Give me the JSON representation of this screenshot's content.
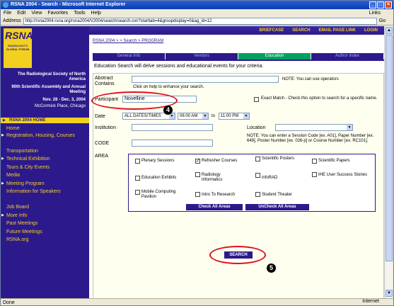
{
  "window": {
    "title": "RSNA 2004 - Search - Microsoft Internet Explorer",
    "controls": [
      "_",
      "□",
      "×"
    ]
  },
  "menu": [
    "File",
    "Edit",
    "View",
    "Favorites",
    "Tools",
    "Help"
  ],
  "links_label": "Links",
  "address": {
    "label": "Address",
    "url": "http://rsna2004.rsna.org/rsna2004/V2004/search/search.cvn?starttab=4&groupdisplay=0&ag_id=12",
    "go": "Go"
  },
  "sidebar": {
    "logo_big": "RSNA'04",
    "logo_sub": "RADIOLOGY'S GLOBAL FORUM",
    "society": "The Radiological Society of North America",
    "assembly": "90th Scientific Assembly and Annual Meeting",
    "dates": "Nov. 28 - Dec. 3, 2004",
    "place": "McCormick Place, Chicago",
    "nav_head": "RSNA 2004 HOME",
    "items": [
      {
        "label": "Home",
        "tri": false
      },
      {
        "label": "Registration, Housing, Courses",
        "tri": true
      },
      {
        "label": "Transportation",
        "tri": false
      },
      {
        "label": "Technical Exhibition",
        "tri": true
      },
      {
        "label": "Tours & City Events",
        "tri": false
      },
      {
        "label": "Media",
        "tri": false
      },
      {
        "label": "Meeting Program",
        "tri": true
      },
      {
        "label": "Information for Speakers",
        "tri": false
      },
      {
        "label": "Job Board",
        "tri": false
      },
      {
        "label": "More Info",
        "tri": true
      },
      {
        "label": "Past Meetings",
        "tri": false
      },
      {
        "label": "Future Meetings",
        "tri": false
      },
      {
        "label": "RSNA.org",
        "tri": false
      }
    ]
  },
  "topbar": [
    "BRIEFCASE",
    "SEARCH",
    "EMAIL PAGE LINK",
    "LOGIN"
  ],
  "breadcrumb": "RSNA 2004 > > Search > PROGRAM",
  "tabs": [
    "General Info",
    "Vendors",
    "Education",
    "Author Index"
  ],
  "intro": "Education Search will delve sessions and educational events for your criteria.",
  "form": {
    "abstract_label": "Abstract Contains",
    "abstract_note": "NOTE: You can use operators",
    "hint": "Click on help to enhance your search.",
    "participant_label": "Participant",
    "participant_value": "Novelline",
    "exact_match": "Exact Match - Check this option to search for a specific name.",
    "date_label": "Date",
    "date_value": "ALL DATES/TIMES",
    "time_from": "06:00 AM",
    "to": "to",
    "time_to": "11:00 PM",
    "institution_label": "Institution",
    "location_label": "Location",
    "code_label": "CODE",
    "code_note": "NOTE: You can enter a Session Code [ex. A01], Paper Number [ex. 649], Poster Number [ex. 026-p] or Course Number [ex. RC101].",
    "area_label": "AREA",
    "areas": [
      {
        "label": "Plenary Sessions",
        "checked": false
      },
      {
        "label": "Refresher Courses",
        "checked": true
      },
      {
        "label": "Scientific Posters",
        "checked": false
      },
      {
        "label": "Scientific Papers",
        "checked": false
      },
      {
        "label": "Education Exhibits",
        "checked": false
      },
      {
        "label": "Radiology Informatics",
        "checked": false
      },
      {
        "label": "infoRAD",
        "checked": false
      },
      {
        "label": "IHE User Success Stories",
        "checked": false
      },
      {
        "label": "Mobile Computing Pavilion",
        "checked": false
      },
      {
        "label": "Intro To Research",
        "checked": false
      },
      {
        "label": "Student Theater",
        "checked": false
      }
    ],
    "check_all": "Check All Areas",
    "uncheck_all": "UnCheck All Areas",
    "search": "SEARCH"
  },
  "callouts": [
    "4",
    "5"
  ],
  "status": {
    "text": "Done",
    "zone": "Internet"
  }
}
